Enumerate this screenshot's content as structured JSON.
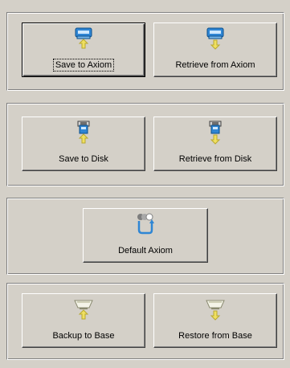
{
  "groups": {
    "axiom": {
      "save_label": "Save to Axiom",
      "retrieve_label": "Retrieve from Axiom"
    },
    "disk": {
      "save_label": "Save to Disk",
      "retrieve_label": "Retrieve from Disk"
    },
    "default": {
      "label": "Default Axiom"
    },
    "base": {
      "backup_label": "Backup to Base",
      "restore_label": "Restore from Base"
    }
  },
  "colors": {
    "background": "#d4d0c8",
    "device_blue": "#3a8fd6",
    "arrow_yellow": "#f0e060"
  }
}
